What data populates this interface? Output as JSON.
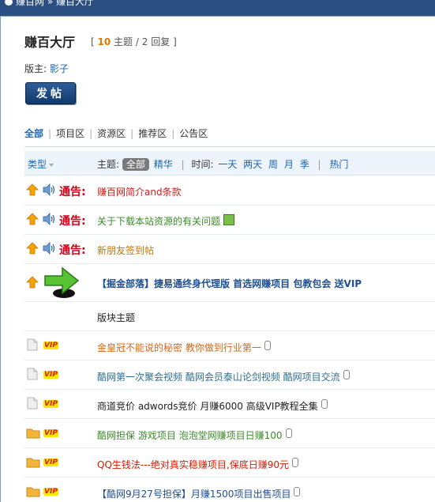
{
  "breadcrumb": {
    "site": "赚百网",
    "separator": "»",
    "current": "赚百大厅"
  },
  "forum": {
    "title": "赚百大厅",
    "stats_open": "[",
    "threads": "10",
    "threads_label": "主题",
    "slash": "/",
    "replies": "2",
    "replies_label": "回复",
    "stats_close": "]",
    "moderator_label": "版主:",
    "moderator": "影子"
  },
  "post_button": "发帖",
  "tabs": [
    "全部",
    "项目区",
    "资源区",
    "推荐区",
    "公告区"
  ],
  "filter": {
    "type_label": "类型",
    "topic_label": "主题:",
    "all": "全部",
    "digest": "精华",
    "time_label": "时间:",
    "times": [
      "一天",
      "两天",
      "周",
      "月",
      "季"
    ],
    "hot": "热门"
  },
  "notices": [
    {
      "label": "通告:",
      "title": "赚百网简介and条款",
      "color": "#c8211d"
    },
    {
      "label": "通告:",
      "title": "关于下载本站资源的有关问题",
      "color": "#3a8a2a"
    },
    {
      "label": "通告:",
      "title": "新朋友签到帖",
      "color": "#c07800"
    }
  ],
  "sticky": {
    "title": "【掘金部落】捷易通终身代理版 首选网赚项目 包教包会 送VIP",
    "color": "#1f4f8f"
  },
  "section_label": "版块主题",
  "threads": [
    {
      "icon": "doc",
      "vip": "VIP",
      "title": "金皇冠不能说的秘密 教你做到行业第一",
      "color": "#d2671c",
      "clip": true
    },
    {
      "icon": "doc",
      "vip": "VIP",
      "title": "酷网第一次聚会视频 酷网会员泰山论剑视频 酷网项目交流",
      "color": "#2e6f8e",
      "clip": true
    },
    {
      "icon": "doc",
      "vip": "VIP",
      "title": "商道竞价 adwords竞价 月赚6000 高级VIP教程全集",
      "color": "#222222",
      "clip": true
    },
    {
      "icon": "folder",
      "vip": "VIP",
      "title": "酷网担保 游戏项目 泡泡堂网赚项目日赚100",
      "color": "#3a8a2a",
      "clip": true
    },
    {
      "icon": "folder",
      "vip": "VIP",
      "title": "QQ生钱法---绝对真实稳赚项目,保底日赚90元",
      "color": "#d81c00",
      "clip": true
    },
    {
      "icon": "folder",
      "vip": "VIP",
      "title": "【酷网9月27号担保】月赚1500项目出售项目",
      "color": "#1f4f8f",
      "clip": true
    }
  ]
}
